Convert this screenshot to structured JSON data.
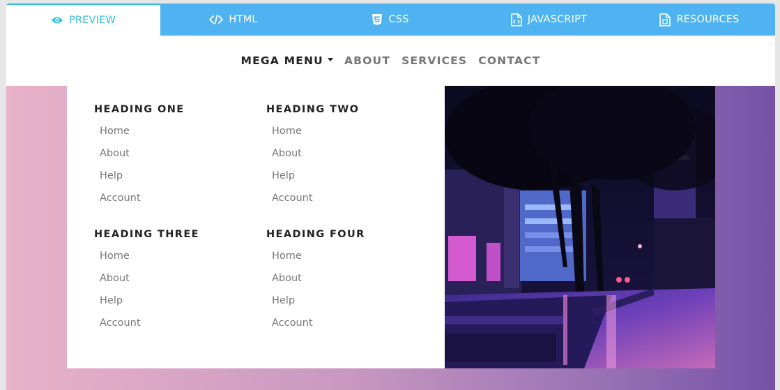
{
  "tabs": [
    {
      "label": "PREVIEW",
      "icon": "eye-icon",
      "active": true
    },
    {
      "label": "HTML",
      "icon": "code-icon",
      "active": false
    },
    {
      "label": "CSS",
      "icon": "css3-icon",
      "active": false
    },
    {
      "label": "JAVASCRIPT",
      "icon": "file-code-icon",
      "active": false
    },
    {
      "label": "RESOURCES",
      "icon": "file-icon",
      "active": false
    }
  ],
  "navbar": {
    "mega_menu": "MEGA MENU",
    "about": "ABOUT",
    "services": "SERVICES",
    "contact": "CONTACT"
  },
  "mega": {
    "columns": [
      {
        "heading": "HEADING ONE",
        "items": [
          "Home",
          "About",
          "Help",
          "Account"
        ]
      },
      {
        "heading": "HEADING TWO",
        "items": [
          "Home",
          "About",
          "Help",
          "Account"
        ]
      },
      {
        "heading": "HEADING THREE",
        "items": [
          "Home",
          "About",
          "Help",
          "Account"
        ]
      },
      {
        "heading": "HEADING FOUR",
        "items": [
          "Home",
          "About",
          "Help",
          "Account"
        ]
      }
    ]
  },
  "colors": {
    "tab_bar": "#4fb3f1",
    "tab_active_text": "#2ec0d8",
    "gradient_start": "#e8b2c8",
    "gradient_end": "#7652a6"
  }
}
